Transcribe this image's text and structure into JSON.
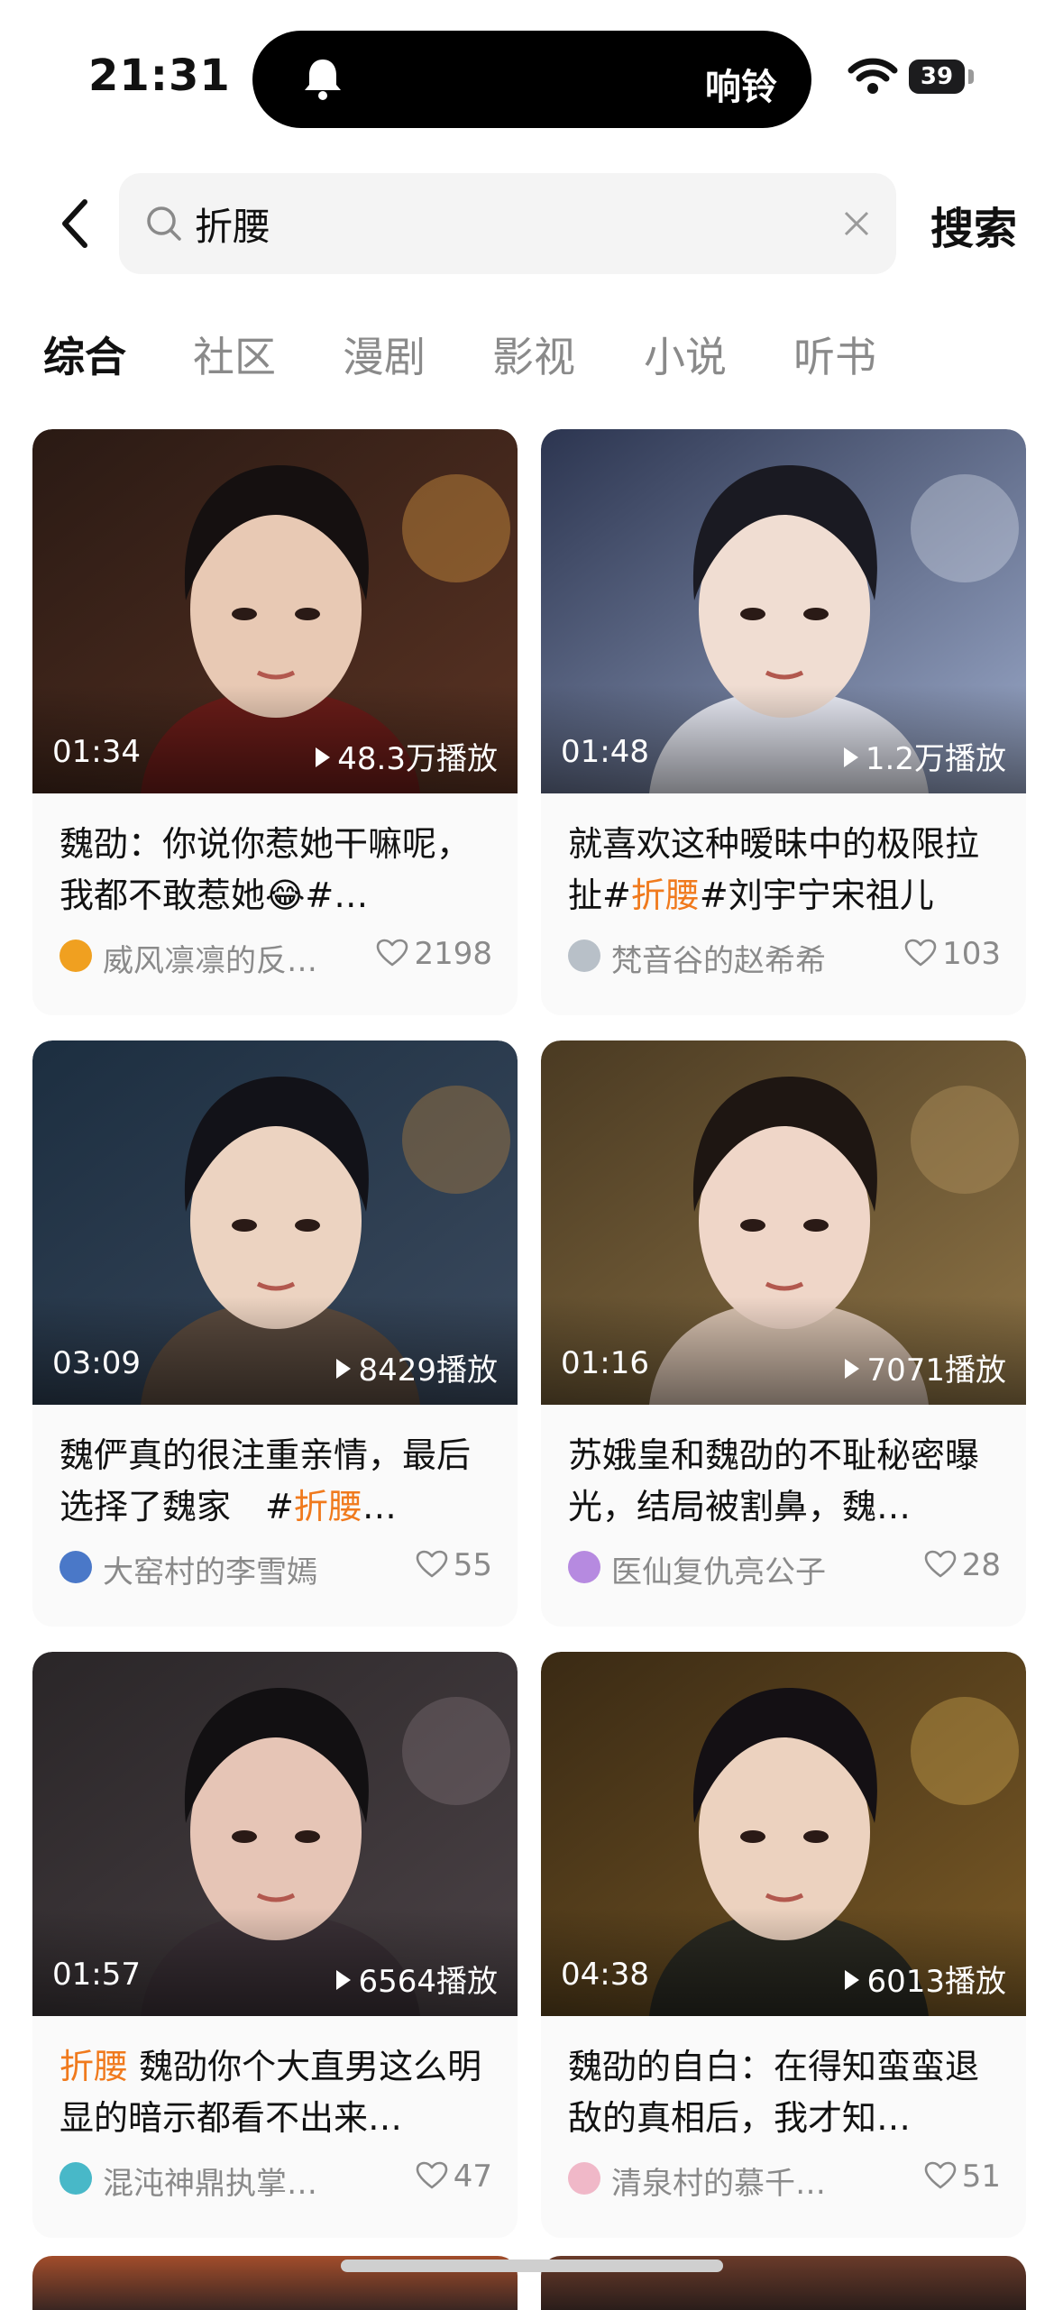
{
  "status_bar": {
    "time": "21:31",
    "activity_label": "响铃",
    "battery": "39"
  },
  "search": {
    "query": "折腰",
    "button": "搜索"
  },
  "tabs": [
    {
      "label": "综合",
      "active": true
    },
    {
      "label": "社区"
    },
    {
      "label": "漫剧"
    },
    {
      "label": "影视"
    },
    {
      "label": "小说"
    },
    {
      "label": "听书"
    }
  ],
  "results": [
    {
      "duration": "01:34",
      "plays": "48.3万播放",
      "title_parts": [
        {
          "t": "魏劭：你说你惹她干嘛呢，我都不敢惹她😂#…"
        }
      ],
      "author": "威风凛凛的反…",
      "likes": "2198"
    },
    {
      "duration": "01:48",
      "plays": "1.2万播放",
      "title_parts": [
        {
          "t": "就喜欢这种暧昧中的极限拉扯#"
        },
        {
          "t": "折腰",
          "hl": true
        },
        {
          "t": "#刘宇宁宋祖儿"
        }
      ],
      "author": "梵音谷的赵希希",
      "likes": "103"
    },
    {
      "duration": "03:09",
      "plays": "8429播放",
      "title_parts": [
        {
          "t": "魏俨真的很注重亲情，最后选择了魏家　#"
        },
        {
          "t": "折腰",
          "hl": true
        },
        {
          "t": "…"
        }
      ],
      "author": "大窑村的李雪嫣",
      "likes": "55"
    },
    {
      "duration": "01:16",
      "plays": "7071播放",
      "title_parts": [
        {
          "t": "苏娥皇和魏劭的不耻秘密曝光，结局被割鼻，魏…"
        }
      ],
      "author": "医仙复仇亮公子",
      "likes": "28"
    },
    {
      "duration": "01:57",
      "plays": "6564播放",
      "title_parts": [
        {
          "t": "折腰",
          "hl": true
        },
        {
          "t": " 魏劭你个大直男这么明显的暗示都看不出来…"
        }
      ],
      "author": "混沌神鼎执掌小莺",
      "likes": "47"
    },
    {
      "duration": "04:38",
      "plays": "6013播放",
      "title_parts": [
        {
          "t": "魏劭的自白：在得知蛮蛮退敌的真相后，我才知…"
        }
      ],
      "author": "清泉村的慕千汐…",
      "likes": "51"
    }
  ],
  "colors": {
    "highlight": "#f07a1d",
    "secondary_text": "#8a8a8a",
    "card_bg": "#fafafa"
  }
}
